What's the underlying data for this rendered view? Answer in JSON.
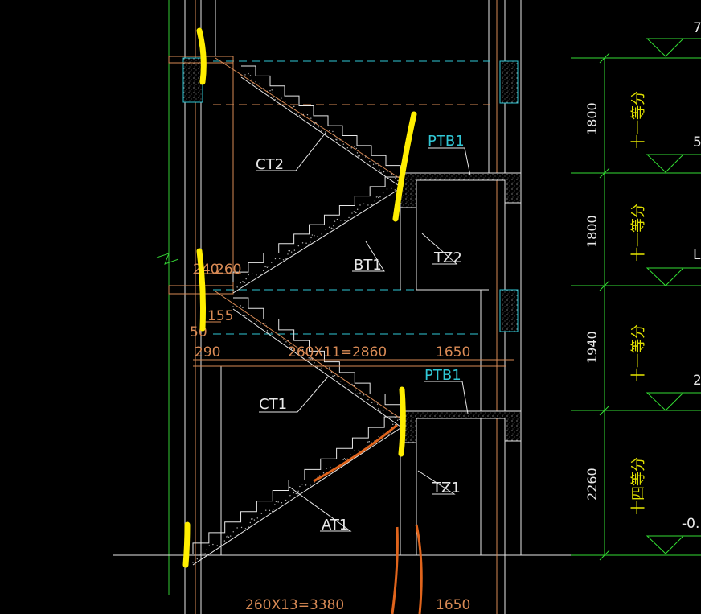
{
  "labels": {
    "ct2": "CT2",
    "ct1": "CT1",
    "bt1": "BT1",
    "at1": "AT1",
    "tz2": "TZ2",
    "tz1": "TZ1",
    "ptb1_upper": "PTB1",
    "ptb1_lower": "PTB1"
  },
  "dimensions": {
    "upper_run": "260X11=2860",
    "lower_run": "260X13=3380",
    "landing_upper": "1650",
    "landing_lower": "1650",
    "left_offset": "290",
    "left_240": "240",
    "left_260": "260",
    "left_155": "155",
    "left_50": "50"
  },
  "level_heights": [
    "1800",
    "1800",
    "1940",
    "2260"
  ],
  "level_notes": [
    "十一等分",
    "十一等分",
    "十一等分",
    "十四等分"
  ],
  "elevation_marks": [
    "7",
    "5",
    "L",
    "2",
    "-0."
  ],
  "colors": {
    "background": "#000000",
    "structure": "#e8e8e8",
    "dimension_orange": "#d88a55",
    "tag_cyan": "#31c8d6",
    "level_green": "#33dd33",
    "highlight_yellow": "#ffee00",
    "annotation_orange": "#e0641c"
  }
}
